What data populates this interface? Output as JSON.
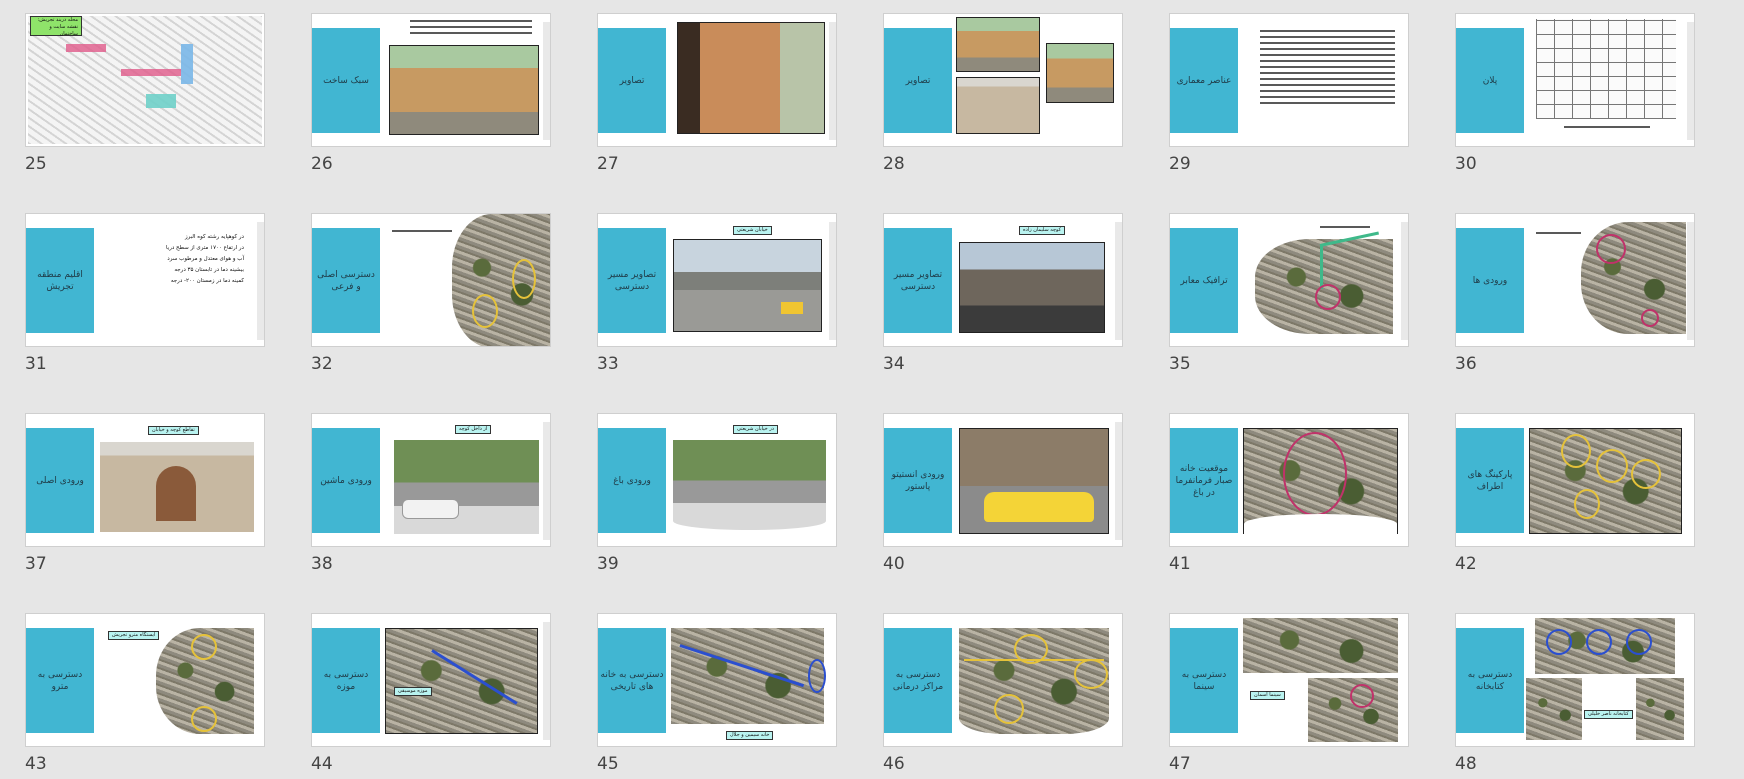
{
  "slides": [
    {
      "num": "25",
      "title": "",
      "labels": [
        "محله دربند تجریش: نقشه سایت و ساختمان"
      ]
    },
    {
      "num": "26",
      "title": "سبک ساخت",
      "labels": []
    },
    {
      "num": "27",
      "title": "تصاویر",
      "labels": []
    },
    {
      "num": "28",
      "title": "تصاویر",
      "labels": []
    },
    {
      "num": "29",
      "title": "عناصر معماری",
      "labels": []
    },
    {
      "num": "30",
      "title": "پلان",
      "labels": []
    },
    {
      "num": "31",
      "title": "اقلیم منطقه تجریش",
      "labels": []
    },
    {
      "num": "32",
      "title": "دسترسی اصلی و فرعی",
      "labels": []
    },
    {
      "num": "33",
      "title": "تصاویر مسیر دسترسی",
      "labels": [
        "خیابان شریعتی"
      ]
    },
    {
      "num": "34",
      "title": "تصاویر مسیر دسترسی",
      "labels": [
        "کوچه سلیمان زاده"
      ]
    },
    {
      "num": "35",
      "title": "ترافیک معابر",
      "labels": []
    },
    {
      "num": "36",
      "title": "ورودی ها",
      "labels": []
    },
    {
      "num": "37",
      "title": "ورودی اصلی",
      "labels": [
        "تقاطع کوچه و خیابان"
      ]
    },
    {
      "num": "38",
      "title": "ورودی ماشین",
      "labels": [
        "از داخل کوچه"
      ]
    },
    {
      "num": "39",
      "title": "ورودی باغ",
      "labels": [
        "در خیابان شریعتی"
      ]
    },
    {
      "num": "40",
      "title": "ورودی انستیتو پاستور",
      "labels": []
    },
    {
      "num": "41",
      "title": "موقعیت خانه صبار فرمانفرما در باغ",
      "labels": []
    },
    {
      "num": "42",
      "title": "پارکینگ های اطراف",
      "labels": []
    },
    {
      "num": "43",
      "title": "دسترسی به مترو",
      "labels": [
        "ایستگاه مترو تجریش"
      ]
    },
    {
      "num": "44",
      "title": "دسترسی به موزه",
      "labels": [
        "موزه موسیقی"
      ]
    },
    {
      "num": "45",
      "title": "دسترسی به خانه های تاریخی",
      "labels": [
        "خانه سیمین و جلال"
      ]
    },
    {
      "num": "46",
      "title": "دسترسی به مراکز درمانی",
      "labels": []
    },
    {
      "num": "47",
      "title": "دسترسی به سینما",
      "labels": [
        "سینما آسمان"
      ]
    },
    {
      "num": "48",
      "title": "دسترسی به کتابخانه",
      "labels": [
        "کتابخانه ناصر خلیلی"
      ]
    }
  ],
  "slide31_bullets": [
    "در کوهپایه رشته کوه البرز",
    "در ارتفاع ۱۷۰۰ متری از سطح دریا",
    "آب و هوای معتدل و مرطوب سرد",
    "بیشینه دما در تابستان ۳۵ درجه",
    "کمینه دما در زمستان ۲۰۰- درجه"
  ],
  "colors": {
    "band": "#41b6d2",
    "background": "#e6e6e6",
    "label": "#b9f3f0"
  }
}
